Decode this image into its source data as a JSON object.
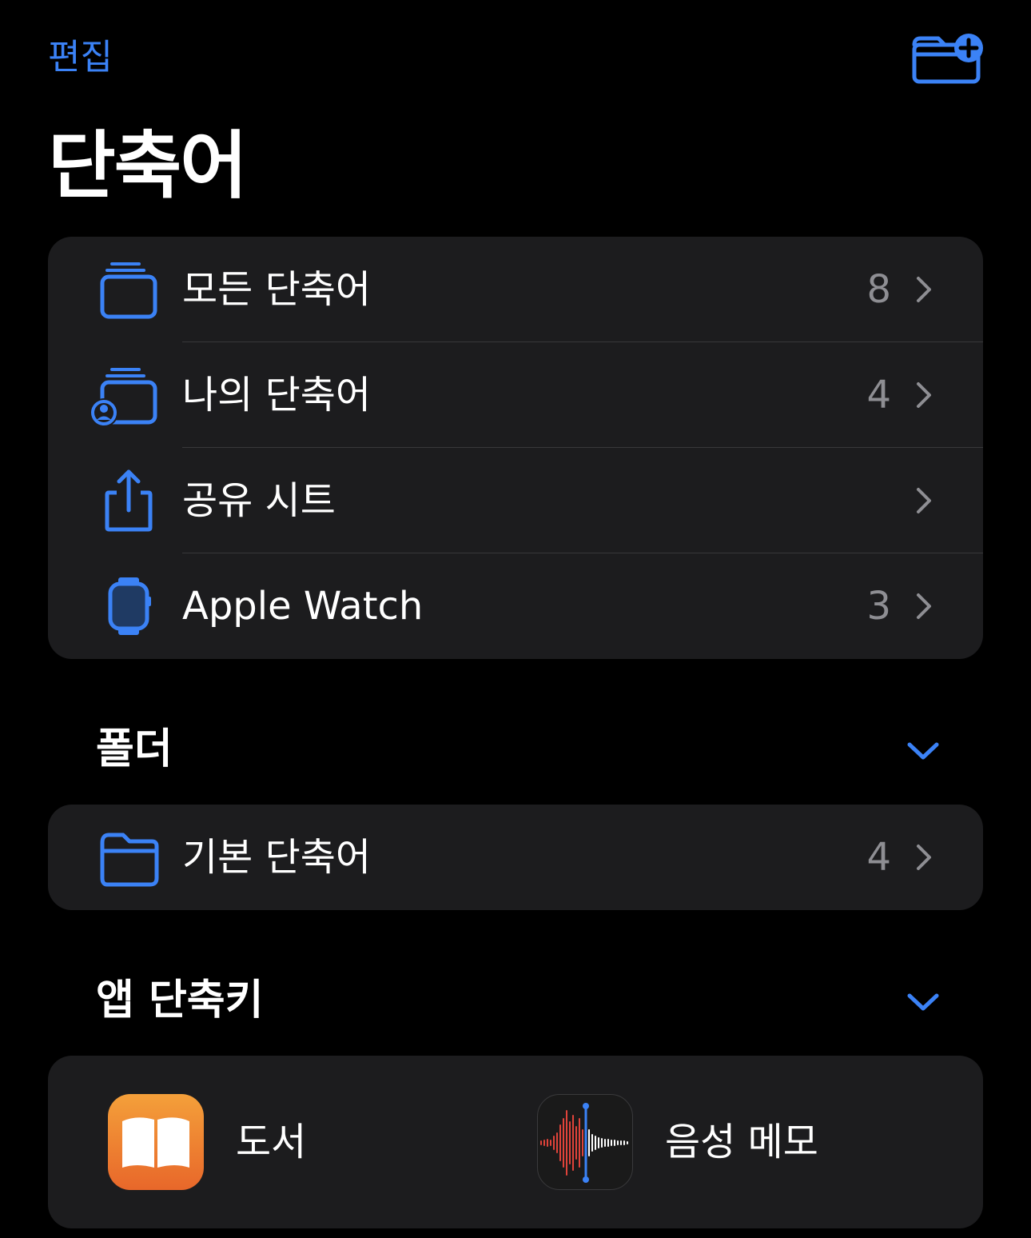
{
  "header": {
    "edit_label": "편집",
    "new_folder_icon": "folder-plus-icon",
    "title": "단축어"
  },
  "library": {
    "rows": [
      {
        "label": "모든 단축어",
        "count": "8",
        "icon": "stacked-cards-icon"
      },
      {
        "label": "나의 단축어",
        "count": "4",
        "icon": "stacked-cards-person-icon"
      },
      {
        "label": "공유 시트",
        "count": "",
        "icon": "share-icon"
      },
      {
        "label": "Apple Watch",
        "count": "3",
        "icon": "apple-watch-icon"
      }
    ]
  },
  "folders": {
    "header": "폴더",
    "items": [
      {
        "label": "기본 단축어",
        "count": "4",
        "icon": "folder-icon"
      }
    ]
  },
  "app_shortcuts": {
    "header": "앱 단축키",
    "apps": [
      {
        "label": "도서",
        "icon": "books-app-icon"
      },
      {
        "label": "음성 메모",
        "icon": "voice-memos-app-icon"
      }
    ]
  },
  "colors": {
    "accent": "#3b82f6",
    "background": "#000000",
    "card": "#1c1c1e",
    "secondary_text": "#8e8e93",
    "divider": "#38383a",
    "books_gradient_top": "#f4a03a",
    "books_gradient_bottom": "#e8672a",
    "voice_memo_red": "#e0433a"
  }
}
